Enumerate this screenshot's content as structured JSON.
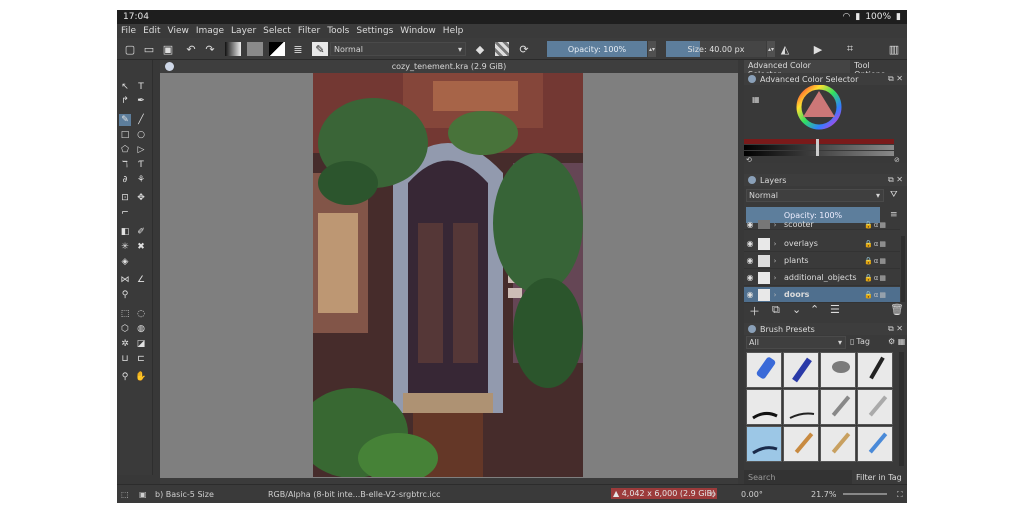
{
  "system_bar": {
    "time": "17:04",
    "battery": "100%"
  },
  "menu": [
    "File",
    "Edit",
    "View",
    "Image",
    "Layer",
    "Select",
    "Filter",
    "Tools",
    "Settings",
    "Window",
    "Help"
  ],
  "toolbar": {
    "blend_mode": "Normal",
    "opacity_label": "Opacity: 100%",
    "size_label": "Size: 40.00 px"
  },
  "document": {
    "title": "cozy_tenement.kra (2.9 GiB)"
  },
  "dock": {
    "tabs": [
      "Advanced Color Selector",
      "Tool Options"
    ],
    "color_selector_title": "Advanced Color Selector",
    "layers_title": "Layers",
    "layers_blend": "Normal",
    "layers_opacity": "Opacity:  100%",
    "layers": [
      {
        "name": "scooter",
        "selected": false
      },
      {
        "name": "overlays",
        "selected": false
      },
      {
        "name": "plants",
        "selected": false
      },
      {
        "name": "additional_objects",
        "selected": false
      },
      {
        "name": "doors",
        "selected": true
      }
    ],
    "brush_presets_title": "Brush Presets",
    "brush_filter": "All",
    "tag_label": "Tag",
    "search_placeholder": "Search",
    "filter_in_tag": "Filter in Tag"
  },
  "statusbar": {
    "brush": "b) Basic-5 Size",
    "color_space": "RGB/Alpha (8-bit inte...B-elle-V2-srgbtrc.icc",
    "image_size": "4,042 x 6,000 (2.9 GiB)",
    "rotation": "0.00°",
    "zoom": "21.7%"
  },
  "colors": {
    "accent": "#5d7e9c",
    "background": "#383838",
    "canvas_bg": "#7f7f7f",
    "warning": "#9c3b3b"
  }
}
